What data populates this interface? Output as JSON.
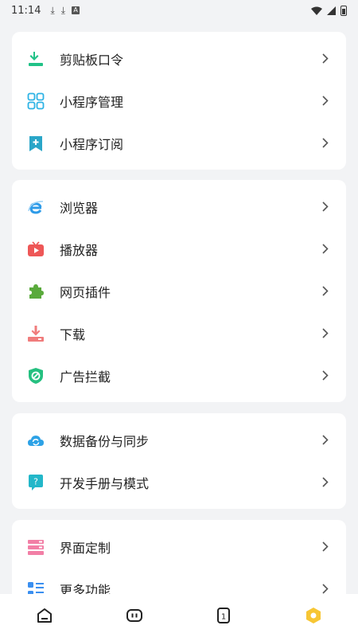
{
  "status": {
    "time": "11:14"
  },
  "groups": [
    {
      "items": [
        {
          "label": "剪贴板口令",
          "icon": "clipboard-download-icon"
        },
        {
          "label": "小程序管理",
          "icon": "grid-apps-icon"
        },
        {
          "label": "小程序订阅",
          "icon": "bookmark-add-icon"
        }
      ]
    },
    {
      "items": [
        {
          "label": "浏览器",
          "icon": "browser-e-icon"
        },
        {
          "label": "播放器",
          "icon": "tv-play-icon"
        },
        {
          "label": "网页插件",
          "icon": "puzzle-icon"
        },
        {
          "label": "下载",
          "icon": "download-icon"
        },
        {
          "label": "广告拦截",
          "icon": "shield-block-icon"
        }
      ]
    },
    {
      "items": [
        {
          "label": "数据备份与同步",
          "icon": "cloud-sync-icon"
        },
        {
          "label": "开发手册与模式",
          "icon": "help-bubble-icon"
        }
      ]
    },
    {
      "items": [
        {
          "label": "界面定制",
          "icon": "layout-custom-icon"
        },
        {
          "label": "更多功能",
          "icon": "more-list-icon"
        }
      ]
    }
  ],
  "nav": {
    "tab_count": "1"
  },
  "colors": {
    "background": "#f2f3f5",
    "card": "#ffffff",
    "accent_yellow": "#f7c634"
  }
}
